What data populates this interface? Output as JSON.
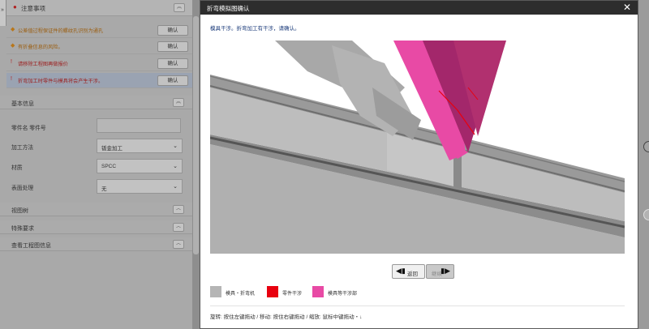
{
  "left_panel": {
    "expand_arrow": "»",
    "notes": {
      "title": "注意事项",
      "collapse_glyph": "︽",
      "items": [
        {
          "marker": "◆",
          "level": "warn",
          "text": "公差值过程保证件的螺纹孔识别为通孔",
          "button": "确认",
          "highlight": false
        },
        {
          "marker": "◆",
          "level": "warn",
          "text": "有折叠信息的风险。",
          "button": "确认",
          "highlight": false
        },
        {
          "marker": "!",
          "level": "error",
          "text": "请移除工程图再做报价",
          "button": "确认",
          "highlight": false
        },
        {
          "marker": "!",
          "level": "error",
          "text": "折弯加工时零件与模具将会产生干涉。",
          "button": "确认",
          "highlight": true
        }
      ]
    },
    "basic_info": {
      "title": "基本信息",
      "collapse_glyph": "︽",
      "fields": [
        {
          "label": "零件名 零件号",
          "type": "input",
          "value": ""
        },
        {
          "label": "加工方法",
          "type": "select",
          "value": "钣金加工"
        },
        {
          "label": "材质",
          "type": "select",
          "value": "SPCC"
        },
        {
          "label": "表面处理",
          "type": "select",
          "value": "无"
        }
      ]
    },
    "sections": [
      {
        "title": "视图树",
        "glyph": "︿"
      },
      {
        "title": "特殊要求",
        "glyph": "︿"
      },
      {
        "title": "查看工程图信息",
        "glyph": "︿"
      }
    ]
  },
  "modal": {
    "title": "折弯模拟图确认",
    "close_glyph": "✕",
    "message": "模具干涉。折弯加工有干涉，请确认。",
    "prev_button": {
      "icon": "◀▮",
      "label": "返回"
    },
    "next_button": {
      "icon": "▮▶",
      "label": "继续"
    },
    "legend": [
      {
        "color": "#b5b5b5",
        "label": "模具・折弯机"
      },
      {
        "color": "#e8000f",
        "label": "零件干涉"
      },
      {
        "color": "#e84aa5",
        "label": "模具等干涉部"
      }
    ],
    "hint": "旋转: 按住左键拖动 / 移动: 按住右键拖动 / 缩放: 鼠标中键拖动・↓"
  },
  "colors": {
    "title_bar": "#2d2d2d",
    "machine_gray": "#b5b5b5",
    "interference_red": "#e8000f",
    "interference_pink": "#e84aa5",
    "message_blue": "#1a3a7a"
  }
}
